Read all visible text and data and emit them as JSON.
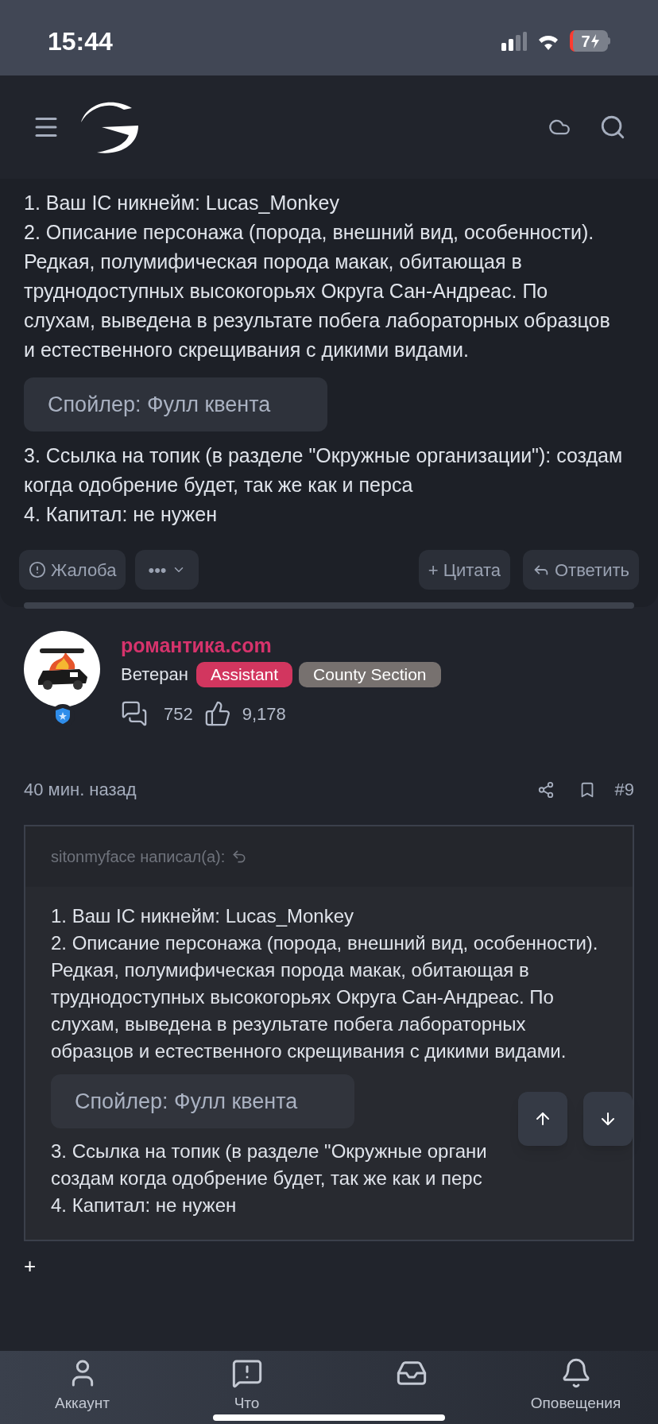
{
  "status_bar": {
    "time": "15:44",
    "battery": "7"
  },
  "post": {
    "lines": [
      "1. Ваш IC никнейм: Lucas_Monkey",
      "2. Описание персонажа (порода, внешний вид, особенности). Редкая, полумифическая порода макак, обитающая в труднодоступных высокогорьях Округа Сан-Андреас. По слухам, выведена в результате побега лабораторных образцов и естественного скрещивания с дикими видами."
    ],
    "spoiler": "Спойлер: Фулл квента",
    "lines_after": [
      "3. Ссылка на топик (в разделе \"Окружные организации\"): создам когда одобрение будет, так же как и перса",
      "4. Капитал: не нужен"
    ],
    "actions": [
      {
        "kind": "report",
        "label": "Жалоба"
      },
      {
        "kind": "more",
        "label": "•••"
      },
      {
        "kind": "quote",
        "label": "+ Цитата"
      },
      {
        "kind": "reply",
        "label": "Ответить"
      }
    ]
  },
  "author": {
    "name": "романтика.com",
    "title": "Ветеран",
    "badges": [
      {
        "label": "Assistant",
        "color": "#d2365f"
      },
      {
        "label": "County Section",
        "color": "#77716f"
      }
    ],
    "messages": "752",
    "reactions": "9,178"
  },
  "post2": {
    "time": "40 мин. назад",
    "number": "#9",
    "quote": {
      "header": "sitonmyface написал(а):",
      "lines": [
        "1. Ваш IC никнейм: Lucas_Monkey",
        "2. Описание персонажа (порода, внешний вид, особенности). Редкая, полумифическая порода макак, обитающая в труднодоступных высокогорьях Округа Сан-Андреас. По слухам, выведена в результате побега лабораторных образцов и естественного скрещивания с дикими видами."
      ],
      "spoiler": "Спойлер: Фулл квента",
      "lines_after": [
        "3. Ссылка на топик (в разделе \"Окружные органи",
        "создам когда одобрение будет, так же как и перс",
        "4. Капитал: не нужен"
      ]
    },
    "expand": "+"
  },
  "bottom_nav": [
    {
      "kind": "user",
      "label": "Аккаунт"
    },
    {
      "kind": "alert",
      "label": "Что"
    },
    {
      "kind": "inbox"
    },
    {
      "kind": "bell",
      "label": "Оповещения"
    }
  ]
}
